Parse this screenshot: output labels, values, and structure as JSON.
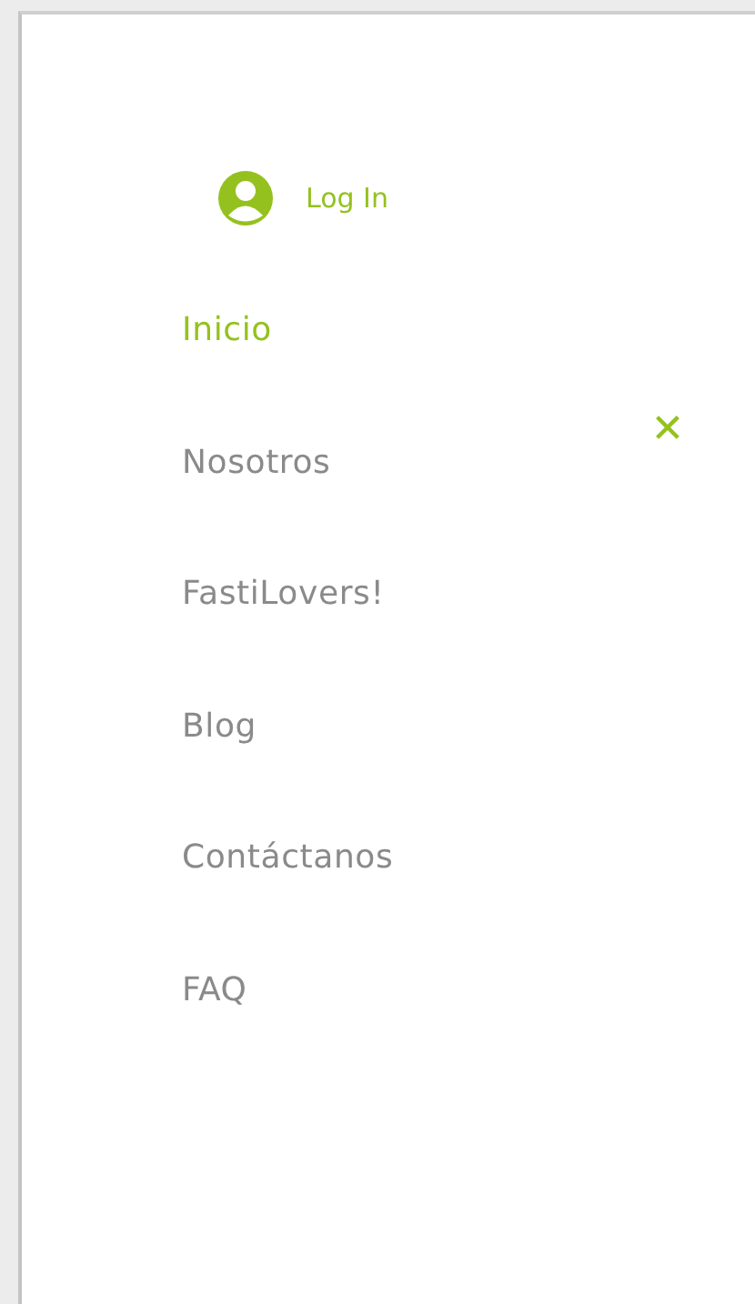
{
  "login": {
    "label": "Log In"
  },
  "menu": [
    {
      "label": "Inicio",
      "selected": true
    },
    {
      "label": "Nosotros",
      "selected": false
    },
    {
      "label": "FastiLovers!",
      "selected": false
    },
    {
      "label": "Blog",
      "selected": false
    },
    {
      "label": "Contáctanos",
      "selected": false
    },
    {
      "label": "FAQ",
      "selected": false
    }
  ],
  "close": {
    "label": "✕"
  }
}
